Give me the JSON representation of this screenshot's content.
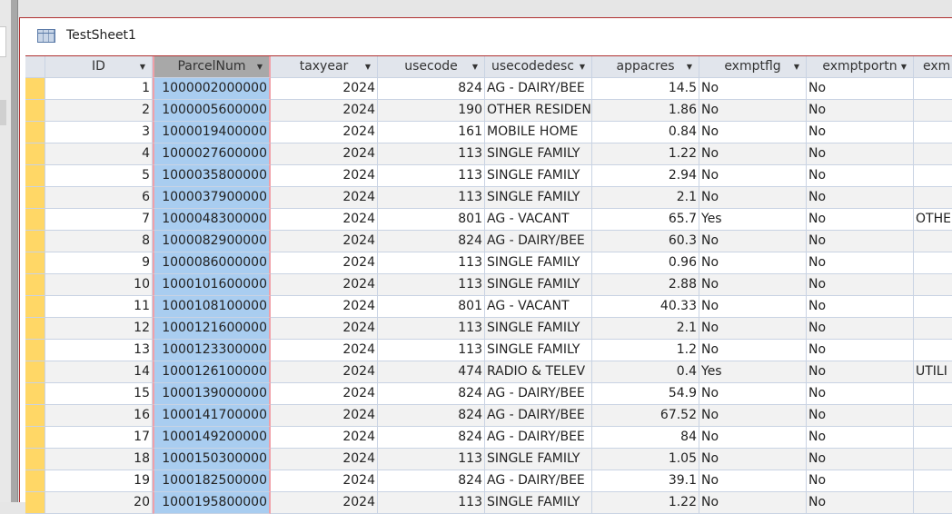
{
  "window": {
    "title": "TestSheet1"
  },
  "columns": [
    "ID",
    "ParcelNum",
    "taxyear",
    "usecode",
    "usecodedesc",
    "appacres",
    "exmptflg",
    "exmptportn",
    "exm"
  ],
  "rows": [
    [
      "1",
      "1000002000000",
      "2024",
      "824",
      "AG - DAIRY/BEE",
      "14.5",
      "No",
      "No",
      ""
    ],
    [
      "2",
      "1000005600000",
      "2024",
      "190",
      "OTHER RESIDEN",
      "1.86",
      "No",
      "No",
      ""
    ],
    [
      "3",
      "1000019400000",
      "2024",
      "161",
      "MOBILE HOME",
      "0.84",
      "No",
      "No",
      ""
    ],
    [
      "4",
      "1000027600000",
      "2024",
      "113",
      "SINGLE FAMILY",
      "1.22",
      "No",
      "No",
      ""
    ],
    [
      "5",
      "1000035800000",
      "2024",
      "113",
      "SINGLE FAMILY",
      "2.94",
      "No",
      "No",
      ""
    ],
    [
      "6",
      "1000037900000",
      "2024",
      "113",
      "SINGLE FAMILY",
      "2.1",
      "No",
      "No",
      ""
    ],
    [
      "7",
      "1000048300000",
      "2024",
      "801",
      "AG - VACANT",
      "65.7",
      "Yes",
      "No",
      "OTHE"
    ],
    [
      "8",
      "1000082900000",
      "2024",
      "824",
      "AG - DAIRY/BEE",
      "60.3",
      "No",
      "No",
      ""
    ],
    [
      "9",
      "1000086000000",
      "2024",
      "113",
      "SINGLE FAMILY",
      "0.96",
      "No",
      "No",
      ""
    ],
    [
      "10",
      "1000101600000",
      "2024",
      "113",
      "SINGLE FAMILY",
      "2.88",
      "No",
      "No",
      ""
    ],
    [
      "11",
      "1000108100000",
      "2024",
      "801",
      "AG - VACANT",
      "40.33",
      "No",
      "No",
      ""
    ],
    [
      "12",
      "1000121600000",
      "2024",
      "113",
      "SINGLE FAMILY",
      "2.1",
      "No",
      "No",
      ""
    ],
    [
      "13",
      "1000123300000",
      "2024",
      "113",
      "SINGLE FAMILY",
      "1.2",
      "No",
      "No",
      ""
    ],
    [
      "14",
      "1000126100000",
      "2024",
      "474",
      "RADIO & TELEV",
      "0.4",
      "Yes",
      "No",
      "UTILI"
    ],
    [
      "15",
      "1000139000000",
      "2024",
      "824",
      "AG - DAIRY/BEE",
      "54.9",
      "No",
      "No",
      ""
    ],
    [
      "16",
      "1000141700000",
      "2024",
      "824",
      "AG - DAIRY/BEE",
      "67.52",
      "No",
      "No",
      ""
    ],
    [
      "17",
      "1000149200000",
      "2024",
      "824",
      "AG - DAIRY/BEE",
      "84",
      "No",
      "No",
      ""
    ],
    [
      "18",
      "1000150300000",
      "2024",
      "113",
      "SINGLE FAMILY",
      "1.05",
      "No",
      "No",
      ""
    ],
    [
      "19",
      "1000182500000",
      "2024",
      "824",
      "AG - DAIRY/BEE",
      "39.1",
      "No",
      "No",
      ""
    ],
    [
      "20",
      "1000195800000",
      "2024",
      "113",
      "SINGLE FAMILY",
      "1.22",
      "No",
      "No",
      ""
    ]
  ]
}
